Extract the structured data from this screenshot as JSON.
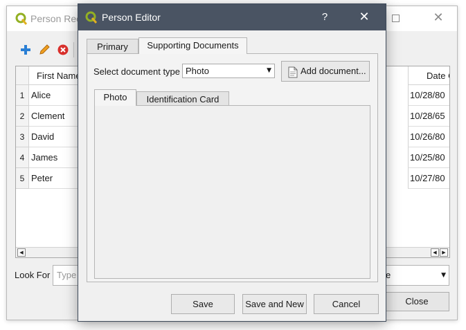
{
  "background_window": {
    "title": "Person Rec",
    "toolbar": {
      "add_icon": "plus-icon",
      "edit_icon": "pencil-icon",
      "delete_icon": "delete-icon"
    },
    "table": {
      "columns": [
        "First Name",
        "Date Of"
      ],
      "rows": [
        {
          "num": "1",
          "first_name": "Alice",
          "date": "10/28/80"
        },
        {
          "num": "2",
          "first_name": "Clement",
          "date": "10/28/65"
        },
        {
          "num": "3",
          "first_name": "David",
          "date": "10/26/80"
        },
        {
          "num": "4",
          "first_name": "James",
          "date": "10/25/80"
        },
        {
          "num": "5",
          "first_name": "Peter",
          "date": "10/27/80"
        }
      ]
    },
    "look_for_label": "Look For",
    "look_for_placeholder": "Type",
    "combo_value": "e",
    "close_label": "Close"
  },
  "dialog": {
    "title": "Person Editor",
    "help_label": "?",
    "close_glyph": "✕",
    "tabs": [
      {
        "label": "Primary",
        "active": false
      },
      {
        "label": "Supporting Documents",
        "active": true
      }
    ],
    "doc_type_label": "Select document type",
    "doc_type_value": "Photo",
    "add_document_label": "Add document...",
    "sub_tabs": [
      {
        "label": "Photo",
        "active": true
      },
      {
        "label": "Identification Card",
        "active": false
      }
    ],
    "buttons": {
      "save": "Save",
      "save_new": "Save and New",
      "cancel": "Cancel"
    }
  },
  "colors": {
    "dialog_titlebar": "#4a5463",
    "qgis_green": "#93b023",
    "add_blue": "#2a7fd4",
    "pencil_orange": "#f0a020",
    "delete_red": "#d9302c"
  }
}
